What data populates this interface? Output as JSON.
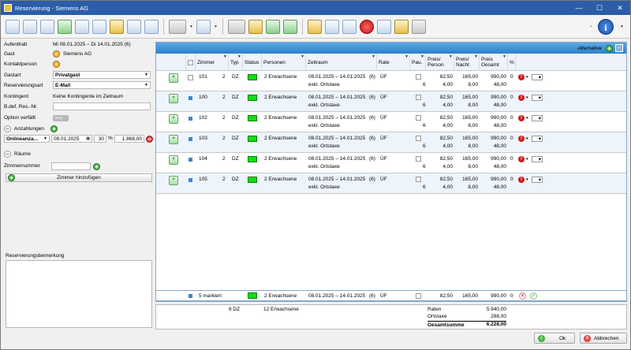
{
  "window": {
    "title": "Reservierung - Siemens AG"
  },
  "toolbar": {
    "buttons": [
      "save-icon",
      "copy-icon",
      "delete-doc-icon",
      "guests-icon",
      "card-icon",
      "new-doc-icon",
      "calendar-icon",
      "edit-icon",
      "list-icon",
      "settings-icon",
      "table-icon",
      "bed-icon",
      "folder-icon",
      "group-icon",
      "room-select-icon",
      "add-page-icon",
      "basket-icon",
      "stop-icon",
      "print-icon",
      "flag-icon",
      "arrow-icon"
    ],
    "info_icon": "info-icon"
  },
  "form": {
    "aufenthalt_label": "Aufenthalt",
    "aufenthalt_value": "Mi 08.01.2025 – Di 14.01.2025 (6)",
    "gast_label": "Gast",
    "gast_value": "Siemens AG",
    "kontakt_label": "Kontaktperson",
    "gastart_label": "Gastart",
    "gastart_value": "Privatgast",
    "resart_label": "Reservierungsart",
    "resart_value": "E-Mail",
    "kontingent_label": "Kontingent",
    "kontingent_value": "Keine Kontingente im Zeitraum",
    "bdef_label": "B.def. Res.-Nr.",
    "option_label": "Option verfällt",
    "option_toggle": "Nein",
    "anzahlungen_label": "Anzahlungen",
    "anz_type": "Onlineanza...",
    "anz_date": "08.01.2025",
    "anz_percent": "30",
    "anz_percent_sign": "%",
    "anz_amount": "1.868,00",
    "raeume_label": "Räume",
    "zimmernummer_label": "Zimmernummer",
    "zimmer_add": "Zimmer hinzufügen",
    "bemerkung_label": "Reservierungsbemerkung"
  },
  "grid": {
    "alternative_label": "Alternative",
    "headers": [
      "Zimmer",
      "Typ",
      "Status",
      "Personen",
      "Zeitraum",
      "Rate",
      "Pau.",
      "Preis/ Person",
      "Preis/ Nacht",
      "Preis Gesamt",
      "%"
    ],
    "rows": [
      {
        "zimmer": "101",
        "anz": "2",
        "typ": "DZ",
        "personen": "2 Erwachsene",
        "zeitraum": "08.01.2025 – 14.01.2025",
        "nights": "(6)",
        "rate": "ÜF",
        "pp": "82,50",
        "pn": "165,00",
        "pg": "990,00",
        "pct": "0",
        "sub_label": "exkl. Ortstaxe",
        "sub_qty": "6",
        "sub_pp": "4,00",
        "sub_pn": "8,00",
        "sub_pg": "48,00"
      },
      {
        "zimmer": "100",
        "anz": "2",
        "typ": "DZ",
        "personen": "2 Erwachsene",
        "zeitraum": "08.01.2025 – 14.01.2025",
        "nights": "(6)",
        "rate": "ÜF",
        "pp": "82,50",
        "pn": "165,00",
        "pg": "990,00",
        "pct": "0",
        "sub_label": "exkl. Ortstaxe",
        "sub_qty": "6",
        "sub_pp": "4,00",
        "sub_pn": "8,00",
        "sub_pg": "48,00"
      },
      {
        "zimmer": "102",
        "anz": "2",
        "typ": "DZ",
        "personen": "2 Erwachsene",
        "zeitraum": "08.01.2025 – 14.01.2025",
        "nights": "(6)",
        "rate": "ÜF",
        "pp": "82,50",
        "pn": "165,00",
        "pg": "990,00",
        "pct": "0",
        "sub_label": "exkl. Ortstaxe",
        "sub_qty": "6",
        "sub_pp": "4,00",
        "sub_pn": "8,00",
        "sub_pg": "48,00"
      },
      {
        "zimmer": "103",
        "anz": "2",
        "typ": "DZ",
        "personen": "2 Erwachsene",
        "zeitraum": "08.01.2025 – 14.01.2025",
        "nights": "(6)",
        "rate": "ÜF",
        "pp": "82,50",
        "pn": "165,00",
        "pg": "990,00",
        "pct": "0",
        "sub_label": "exkl. Ortstaxe",
        "sub_qty": "6",
        "sub_pp": "4,00",
        "sub_pn": "8,00",
        "sub_pg": "48,00"
      },
      {
        "zimmer": "104",
        "anz": "2",
        "typ": "DZ",
        "personen": "2 Erwachsene",
        "zeitraum": "08.01.2025 – 14.01.2025",
        "nights": "(6)",
        "rate": "ÜF",
        "pp": "82,50",
        "pn": "165,00",
        "pg": "990,00",
        "pct": "0",
        "sub_label": "exkl. Ortstaxe",
        "sub_qty": "6",
        "sub_pp": "4,00",
        "sub_pn": "8,00",
        "sub_pg": "48,00"
      },
      {
        "zimmer": "105",
        "anz": "2",
        "typ": "DZ",
        "personen": "2 Erwachsene",
        "zeitraum": "08.01.2025 – 14.01.2025",
        "nights": "(6)",
        "rate": "ÜF",
        "pp": "82,50",
        "pn": "165,00",
        "pg": "990,00",
        "pct": "0",
        "sub_label": "exkl. Ortstaxe",
        "sub_qty": "6",
        "sub_pp": "4,00",
        "sub_pn": "8,00",
        "sub_pg": "48,00"
      }
    ],
    "footer": {
      "marked": "5 markiert",
      "personen": "2 Erwachsene",
      "zeitraum": "08.01.2025 – 14.01.2025",
      "nights": "(6)",
      "rate": "ÜF",
      "pp": "82,50",
      "pn": "165,00",
      "pg": "990,00",
      "pct": "0"
    }
  },
  "totals": {
    "rooms": "6 DZ",
    "persons": "12 Erwachsene",
    "raten_label": "Raten",
    "raten_value": "5.940,00",
    "ortstaxe_label": "Ortstaxe",
    "ortstaxe_value": "288,00",
    "gesamt_label": "Gesamtsumme",
    "gesamt_value": "6.228,00"
  },
  "buttons": {
    "ok": "Ok",
    "cancel": "Abbrechen"
  },
  "colors": {
    "titlebar": "#2b5da8",
    "status_green": "#10e010",
    "grid_header": "#2c80cc"
  }
}
